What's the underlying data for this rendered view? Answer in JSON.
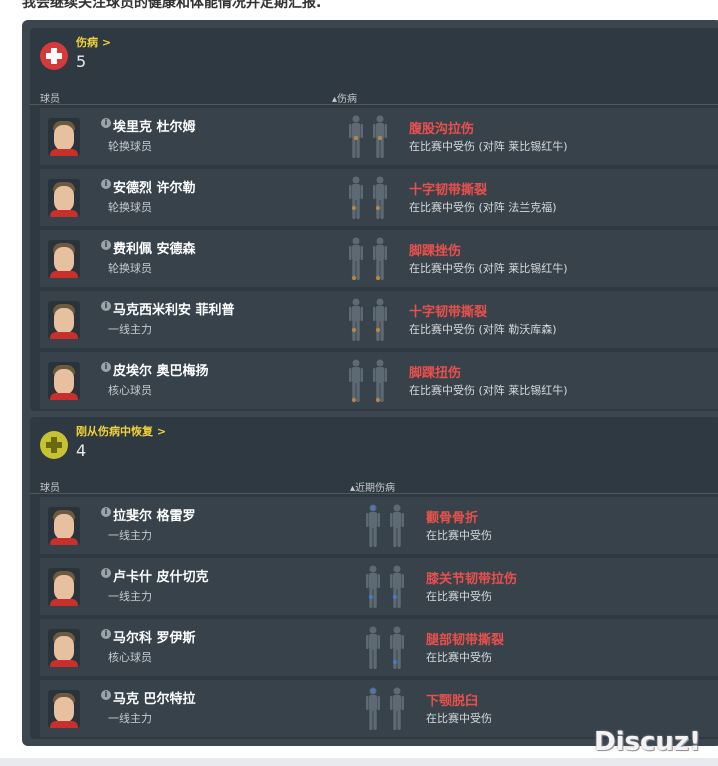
{
  "intro_text": "我会继续关注球员的健康和体能情况并定期汇报.",
  "injured": {
    "title": "伤病 >",
    "count": "5",
    "col_player": "球员",
    "col_injury": "▴伤病",
    "icon": "medical-cross-icon",
    "color": "#d43a3a",
    "rows": [
      {
        "name": "埃里克 杜尔姆",
        "role": "轮换球员",
        "injury": "腹股沟拉伤",
        "desc": "在比赛中受伤 (对阵 莱比锡红牛)",
        "spot": "groin"
      },
      {
        "name": "安德烈 许尔勒",
        "role": "轮换球员",
        "injury": "十字韧带撕裂",
        "desc": "在比赛中受伤 (对阵 法兰克福)",
        "spot": "knee"
      },
      {
        "name": "费利佩 安德森",
        "role": "轮换球员",
        "injury": "脚踝挫伤",
        "desc": "在比赛中受伤 (对阵 莱比锡红牛)",
        "spot": "ankle"
      },
      {
        "name": "马克西米利安 菲利普",
        "role": "一线主力",
        "injury": "十字韧带撕裂",
        "desc": "在比赛中受伤 (对阵 勒沃库森)",
        "spot": "knee"
      },
      {
        "name": "皮埃尔 奥巴梅扬",
        "role": "核心球员",
        "injury": "脚踝扭伤",
        "desc": "在比赛中受伤 (对阵 莱比锡红牛)",
        "spot": "ankle"
      }
    ]
  },
  "recovered": {
    "title": "刚从伤病中恢复 >",
    "count": "4",
    "col_player": "球员",
    "col_injury": "▴近期伤病",
    "icon": "recovery-cross-icon",
    "color": "#c7c230",
    "rows": [
      {
        "name": "拉斐尔 格雷罗",
        "role": "一线主力",
        "injury": "颧骨骨折",
        "desc": "在比赛中受伤",
        "spot": "head"
      },
      {
        "name": "卢卡什 皮什切克",
        "role": "一线主力",
        "injury": "膝关节韧带拉伤",
        "desc": "在比赛中受伤",
        "spot": "knee"
      },
      {
        "name": "马尔科 罗伊斯",
        "role": "核心球员",
        "injury": "腿部韧带撕裂",
        "desc": "在比赛中受伤",
        "spot": "leg"
      },
      {
        "name": "马克 巴尔特拉",
        "role": "一线主力",
        "injury": "下颚脱臼",
        "desc": "在比赛中受伤",
        "spot": "head"
      }
    ]
  },
  "watermark": "Discuz!"
}
